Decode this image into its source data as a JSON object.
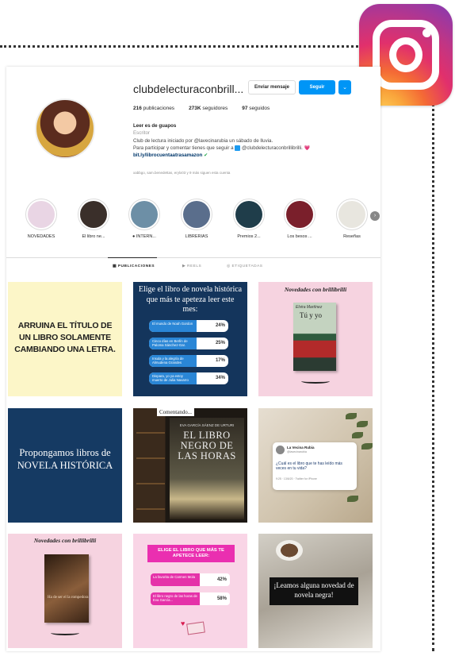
{
  "profile": {
    "username": "clubdelecturaconbrill...",
    "buttons": {
      "message": "Enviar mensaje",
      "follow": "Seguir",
      "dropdown": "⌄"
    },
    "stats": [
      {
        "value": "216",
        "label": "publicaciones"
      },
      {
        "value": "273K",
        "label": "seguidores"
      },
      {
        "value": "97",
        "label": "seguidos"
      }
    ],
    "bio": {
      "name": "Leer es de guapos",
      "category": "Escritor",
      "line1": "Club de lectura iniciado por @lavecinarubia un sábado de lluvia.",
      "line2": "Para participar y comentar tienes que seguir a",
      "line2_handle": "@clubdelecturaconbrillibrilli.",
      "line2_emoji": "💗",
      "link": "bit.ly/librocuentaatrasamazon",
      "verified": "✔"
    },
    "followed_by": "xabbgo, sam.benedettas, erylx03 y 9 más siguen esta cuenta"
  },
  "highlights": [
    {
      "label": "NOVEDADES",
      "color": "#e9d5e4"
    },
    {
      "label": "El libro ne...",
      "color": "#3a2f2a"
    },
    {
      "label": "● INTERN...",
      "color": "#6d8fa6"
    },
    {
      "label": "LIBRERIAS",
      "color": "#5a6e8c"
    },
    {
      "label": "Premios 2...",
      "color": "#1f3d4a"
    },
    {
      "label": "Los besos ...",
      "color": "#7a1f2b"
    },
    {
      "label": "Reseñas",
      "color": "#e8e6df"
    }
  ],
  "tabs": [
    {
      "label": "▦ PUBLICACIONES"
    },
    {
      "label": "▶ REELS"
    },
    {
      "label": "◎ ETIQUETADAS"
    }
  ],
  "posts": {
    "p1": {
      "text": "ARRUINA EL TÍTULO DE UN LIBRO SOLAMENTE CAMBIANDO UNA LETRA."
    },
    "p2": {
      "title": "Elige el libro de novela histórica que más te apeteza leer este mes:",
      "options": [
        {
          "text": "El mundo de Noah Gordon",
          "percent": 24
        },
        {
          "text": "Cinco días en Berlín de Paloma Sánchez-Gar.",
          "percent": 25
        },
        {
          "text": "Insula y la alegría de Almudena Grandes",
          "percent": 17
        },
        {
          "text": "Dispara, yo ya estoy muerto de Julia Navarro",
          "percent": 34
        }
      ]
    },
    "p3": {
      "header": "Novedades con brillibrilli",
      "book_author": "Elvira Martínez",
      "book_title": "Tú y yo"
    },
    "p4": {
      "text": "Propongamos libros de NOVELA HISTÓRICA"
    },
    "p5": {
      "tag": "Comentando...",
      "author": "EVA GARCÍA SÁENZ DE URTURI",
      "title": "EL LIBRO NEGRO DE LAS HORAS"
    },
    "p6": {
      "name": "La Vecina Rubia",
      "handle": "@lavecinarubia",
      "question": "¿Cuál es el libro que te has leído más veces en tu vida?",
      "date": "9:25 · 13/6/20 · Twitter for iPhone"
    },
    "p7": {
      "header": "Novedades con brillibrilli",
      "book_title": "Ha de ser el la rompedora"
    },
    "p8": {
      "header": "ELIGE EL LIBRO QUE MÁS TE APETECE LEER:",
      "options": [
        {
          "text": "La favorita de Carmen Mola",
          "percent": 42
        },
        {
          "text": "El libro negro de las horas de Eva García...",
          "percent": 58
        }
      ]
    },
    "p9": {
      "text": "¡Leamos alguna novedad de novela negra!"
    }
  },
  "colors": {
    "follow_blue": "#0095f6",
    "poll_blue": "#2a86d6",
    "poll_pink": "#e532a9"
  }
}
